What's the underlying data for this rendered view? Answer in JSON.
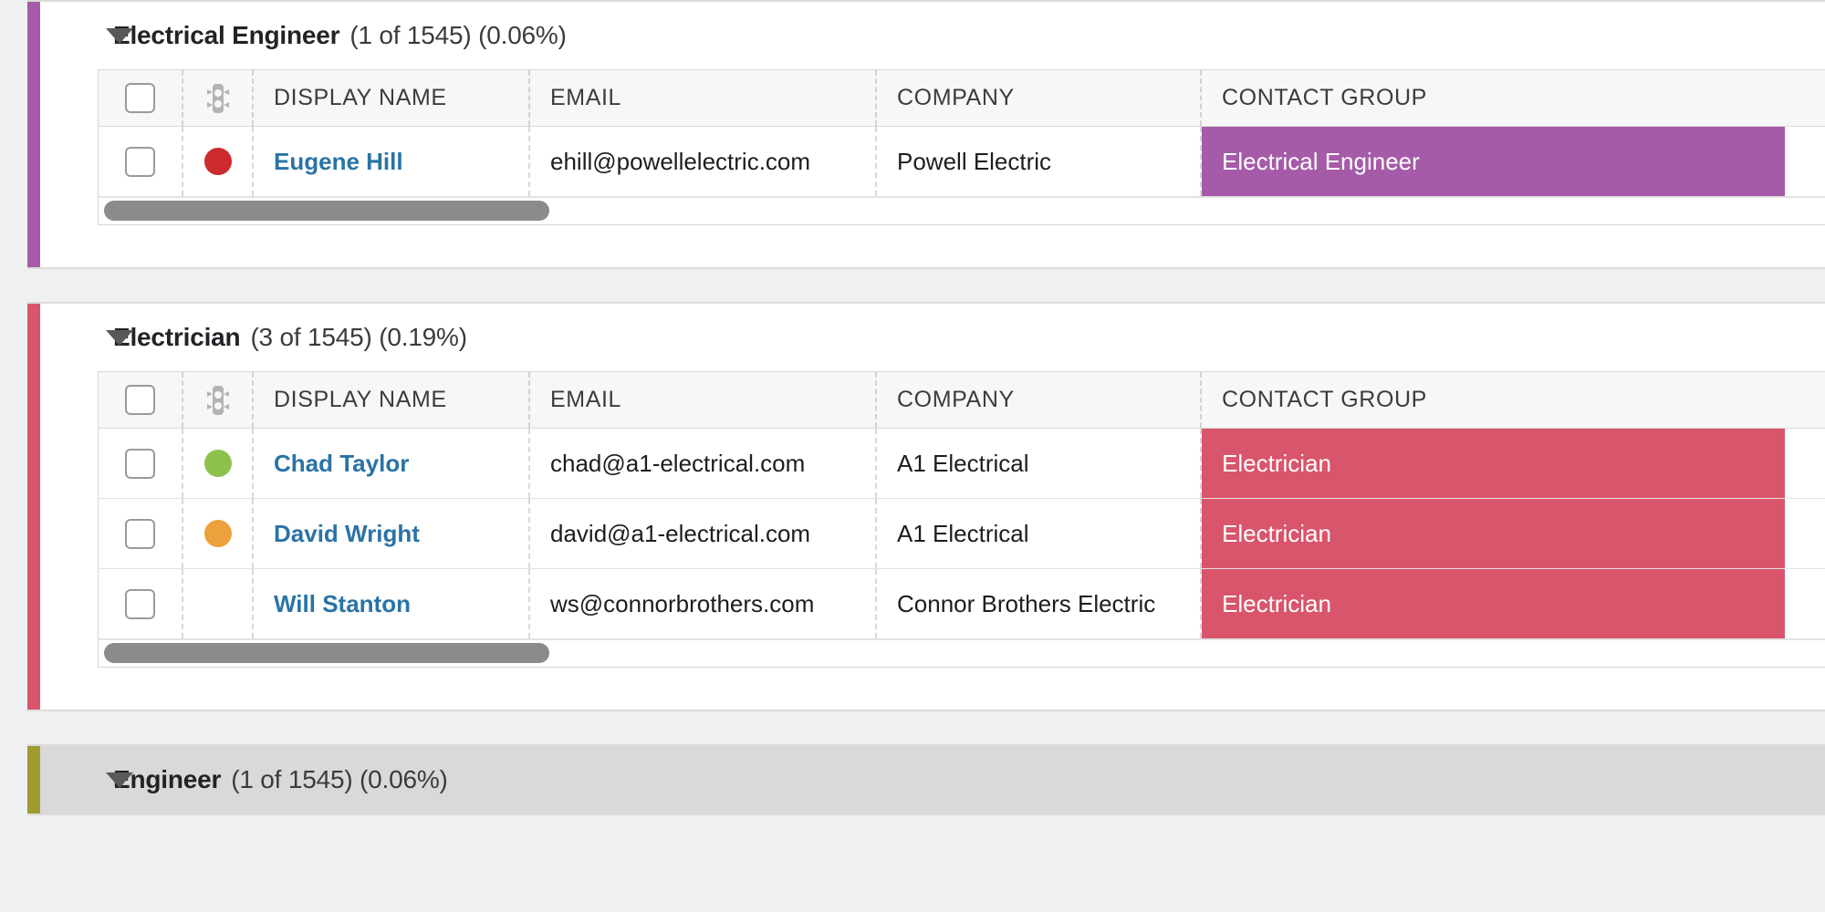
{
  "table": {
    "columns": [
      {
        "key": "checkbox",
        "label": "",
        "icon": "checkbox-icon"
      },
      {
        "key": "status",
        "label": "",
        "icon": "traffic-light-icon"
      },
      {
        "key": "display_name",
        "label": "DISPLAY NAME"
      },
      {
        "key": "email",
        "label": "EMAIL"
      },
      {
        "key": "company",
        "label": "COMPANY"
      },
      {
        "key": "contact_group",
        "label": "CONTACT GROUP"
      }
    ]
  },
  "status_colors": {
    "red": "#cc2a2c",
    "green": "#8cc24c",
    "orange": "#eda13c",
    "none": "transparent"
  },
  "groups": [
    {
      "id": "electrical-engineer",
      "title": "Electrical Engineer",
      "meta": "(1 of 1545) (0.06%)",
      "count": 1,
      "total": 1545,
      "percent": "0.06%",
      "expanded": true,
      "accent_color": "#a55ba8",
      "badge_color": "#a55ba8",
      "active": false,
      "rows": [
        {
          "status": "red",
          "display_name": "Eugene Hill",
          "email": "ehill@powellelectric.com",
          "company": "Powell Electric",
          "contact_group": "Electrical Engineer"
        }
      ],
      "scrollbar": {
        "thumb_width": 488
      }
    },
    {
      "id": "electrician",
      "title": "Electrician",
      "meta": "(3 of 1545) (0.19%)",
      "count": 3,
      "total": 1545,
      "percent": "0.19%",
      "expanded": true,
      "accent_color": "#d9556b",
      "badge_color": "#d9556b",
      "active": false,
      "rows": [
        {
          "status": "green",
          "display_name": "Chad Taylor",
          "email": "chad@a1-electrical.com",
          "company": "A1 Electrical",
          "contact_group": "Electrician"
        },
        {
          "status": "orange",
          "display_name": "David Wright",
          "email": "david@a1-electrical.com",
          "company": "A1 Electrical",
          "contact_group": "Electrician"
        },
        {
          "status": "none",
          "display_name": "Will Stanton",
          "email": "ws@connorbrothers.com",
          "company": "Connor Brothers Electric",
          "contact_group": "Electrician"
        }
      ],
      "scrollbar": {
        "thumb_width": 488
      }
    },
    {
      "id": "engineer",
      "title": "Engineer",
      "meta": "(1 of 1545) (0.06%)",
      "count": 1,
      "total": 1545,
      "percent": "0.06%",
      "expanded": true,
      "accent_color": "#a09b2e",
      "badge_color": "#a09b2e",
      "active": true,
      "rows": [],
      "scrollbar": {
        "thumb_width": 488
      }
    }
  ]
}
